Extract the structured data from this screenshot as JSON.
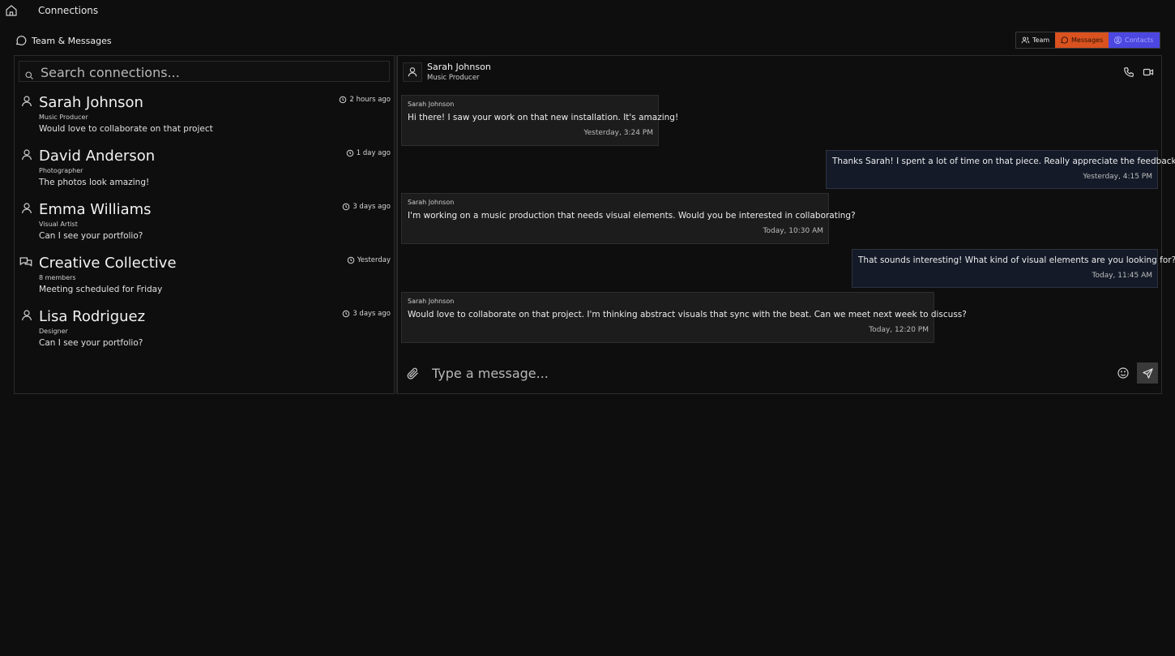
{
  "app": {
    "title": "Connections"
  },
  "section": {
    "title": "Team & Messages"
  },
  "tabs": [
    {
      "label": "Team",
      "icon": "users-icon"
    },
    {
      "label": "Messages",
      "icon": "message-icon",
      "active": true,
      "color": "#d9521f"
    },
    {
      "label": "Contacts",
      "icon": "contacts-icon",
      "color": "#4b47e0"
    }
  ],
  "search": {
    "placeholder": "Search connections..."
  },
  "contacts": [
    {
      "name": "Sarah Johnson",
      "role": "Music Producer",
      "preview": "Would love to collaborate on that project",
      "time": "2 hours ago",
      "icon": "user-icon"
    },
    {
      "name": "David Anderson",
      "role": "Photographer",
      "preview": "The photos look amazing!",
      "time": "1 day ago",
      "icon": "user-icon"
    },
    {
      "name": "Emma Williams",
      "role": "Visual Artist",
      "preview": "Can I see your portfolio?",
      "time": "3 days ago",
      "icon": "user-icon"
    },
    {
      "name": "Creative Collective",
      "role": "8 members",
      "preview": "Meeting scheduled for Friday",
      "time": "Yesterday",
      "icon": "group-chat-icon"
    },
    {
      "name": "Lisa Rodriguez",
      "role": "Designer",
      "preview": "Can I see your portfolio?",
      "time": "3 days ago",
      "icon": "user-icon"
    }
  ],
  "chat": {
    "name": "Sarah Johnson",
    "role": "Music Producer",
    "messages": [
      {
        "direction": "in",
        "sender": "Sarah Johnson",
        "text": "Hi there! I saw your work on that new installation. It's amazing!",
        "time": "Yesterday, 3:24 PM"
      },
      {
        "direction": "out",
        "text": "Thanks Sarah! I spent a lot of time on that piece. Really appreciate the feedback.",
        "time": "Yesterday, 4:15 PM"
      },
      {
        "direction": "in",
        "sender": "Sarah Johnson",
        "text": "I'm working on a music production that needs visual elements. Would you be interested in collaborating?",
        "time": "Today, 10:30 AM"
      },
      {
        "direction": "out",
        "text": "That sounds interesting! What kind of visual elements are you looking for?",
        "time": "Today, 11:45 AM"
      },
      {
        "direction": "in",
        "sender": "Sarah Johnson",
        "text": "Would love to collaborate on that project. I'm thinking abstract visuals that sync with the beat. Can we meet next week to discuss?",
        "time": "Today, 12:20 PM"
      }
    ]
  },
  "compose": {
    "placeholder": "Type a message..."
  }
}
